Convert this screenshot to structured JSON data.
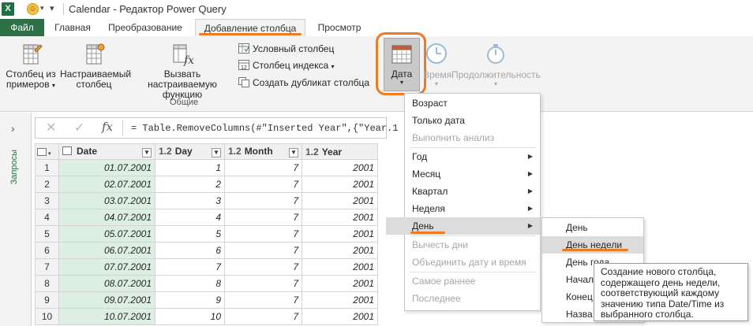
{
  "window": {
    "title": "Calendar - Редактор Power Query",
    "app_icon_letter": "X"
  },
  "tabs": {
    "file": "Файл",
    "home": "Главная",
    "transform": "Преобразование",
    "add_column": "Добавление столбца",
    "view": "Просмотр"
  },
  "ribbon": {
    "col_from_examples": [
      "Столбец из",
      "примеров"
    ],
    "custom_column": [
      "Настраиваемый",
      "столбец"
    ],
    "invoke_custom_function": [
      "Вызвать настраиваемую",
      "функцию"
    ],
    "conditional_column": "Условный столбец",
    "index_column": "Столбец индекса",
    "duplicate_column": "Создать дубликат столбца",
    "general_group": "Общие",
    "date": "Дата",
    "time": "Время",
    "duration": "Продолжительность"
  },
  "left_pane": {
    "queries": "Запросы"
  },
  "formula": {
    "text": "= Table.RemoveColumns(#\"Inserted Year\",{\"Year.1"
  },
  "table": {
    "columns": [
      {
        "type": "calendar",
        "name": "Date"
      },
      {
        "type": "1.2",
        "name": "Day"
      },
      {
        "type": "1.2",
        "name": "Month"
      },
      {
        "type": "1.2",
        "name": "Year"
      }
    ],
    "rows": [
      [
        "1",
        "01.07.2001",
        "1",
        "7",
        "2001"
      ],
      [
        "2",
        "02.07.2001",
        "2",
        "7",
        "2001"
      ],
      [
        "3",
        "03.07.2001",
        "3",
        "7",
        "2001"
      ],
      [
        "4",
        "04.07.2001",
        "4",
        "7",
        "2001"
      ],
      [
        "5",
        "05.07.2001",
        "5",
        "7",
        "2001"
      ],
      [
        "6",
        "06.07.2001",
        "6",
        "7",
        "2001"
      ],
      [
        "7",
        "07.07.2001",
        "7",
        "7",
        "2001"
      ],
      [
        "8",
        "08.07.2001",
        "8",
        "7",
        "2001"
      ],
      [
        "9",
        "09.07.2001",
        "9",
        "7",
        "2001"
      ],
      [
        "10",
        "10.07.2001",
        "10",
        "7",
        "2001"
      ]
    ]
  },
  "date_menu": {
    "items": [
      {
        "label": "Возраст",
        "disabled": false
      },
      {
        "label": "Только дата",
        "disabled": false
      },
      {
        "label": "Выполнить анализ",
        "disabled": true
      },
      {
        "label": "Год",
        "disabled": false,
        "submenu": true
      },
      {
        "label": "Месяц",
        "disabled": false,
        "submenu": true
      },
      {
        "label": "Квартал",
        "disabled": false,
        "submenu": true
      },
      {
        "label": "Неделя",
        "disabled": false,
        "submenu": true
      },
      {
        "label": "День",
        "disabled": false,
        "submenu": true,
        "highlighted": true
      },
      {
        "label": "Вычесть дни",
        "disabled": true
      },
      {
        "label": "Объединить дату и время",
        "disabled": true
      },
      {
        "label": "Самое раннее",
        "disabled": true
      },
      {
        "label": "Последнее",
        "disabled": true
      }
    ]
  },
  "day_submenu": {
    "items": [
      "День",
      "День недели",
      "День года",
      "Начало",
      "Конец",
      "Назва"
    ]
  },
  "tooltip": {
    "text": "Создание нового столбца, содержащего день недели, соответствующий каждому значению типа Date/Time из выбранного столбца."
  },
  "colors": {
    "file_tab": "#2f7147",
    "annotation_orange": "#ee7a23",
    "date_column_bg": "#ddefe3"
  }
}
